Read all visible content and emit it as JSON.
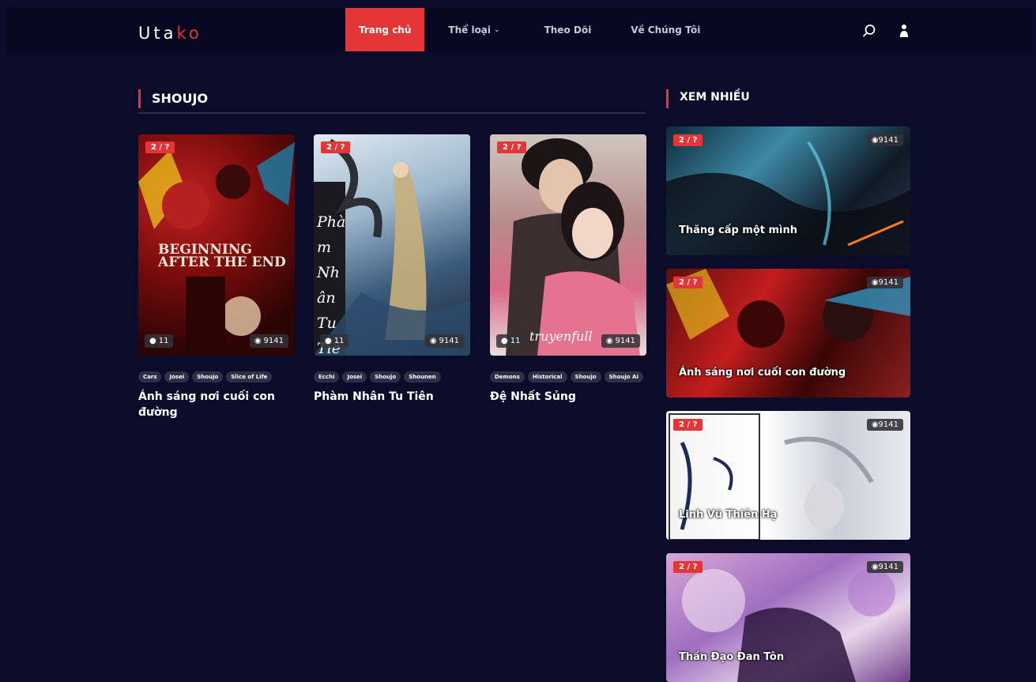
{
  "header": {
    "logo_main": "Uta",
    "logo_accent": "ko",
    "nav": [
      {
        "label": "Trang chủ",
        "active": true
      },
      {
        "label": "Thể loại",
        "active": false,
        "dropdown": true
      },
      {
        "label": "Theo Dõi",
        "active": false
      },
      {
        "label": "Về Chúng Tôi",
        "active": false
      }
    ],
    "icons": [
      "search-icon",
      "user-icon"
    ]
  },
  "main": {
    "section_title": "SHOUJO",
    "cards": [
      {
        "episode": "2 / ?",
        "comments": "11",
        "views": "9141",
        "tags": [
          "Cars",
          "Josei",
          "Shoujo",
          "Slice of Life"
        ],
        "title": "Ánh sáng nơi cuối con đường",
        "art_text": "BEGINNING AFTER THE END"
      },
      {
        "episode": "2 / ?",
        "comments": "11",
        "views": "9141",
        "tags": [
          "Ecchi",
          "Josei",
          "Shoujo",
          "Shounen"
        ],
        "title": "Phàm Nhân Tu Tiên",
        "art_text": "Phàm Nhân Tu Tiên"
      },
      {
        "episode": "2 / ?",
        "comments": "11",
        "views": "9141",
        "tags": [
          "Demons",
          "Historical",
          "Shoujo",
          "Shoujo Ai"
        ],
        "title": "Đệ Nhất Sủng",
        "art_text": "truyenfull"
      }
    ]
  },
  "sidebar": {
    "section_title": "XEM NHIỀU",
    "items": [
      {
        "episode": "2 / ?",
        "views": "9141",
        "title": "Thăng cấp một mình"
      },
      {
        "episode": "2 / ?",
        "views": "9141",
        "title": "Ánh sáng nơi cuối con đường"
      },
      {
        "episode": "2 / ?",
        "views": "9141",
        "title": "Linh Vũ Thiên Hạ"
      },
      {
        "episode": "2 / ?",
        "views": "9141",
        "title": "Thần Đạo Đan Tôn"
      }
    ]
  },
  "colors": {
    "accent": "#e53637",
    "background": "#0b0c2a",
    "header": "#070720"
  }
}
